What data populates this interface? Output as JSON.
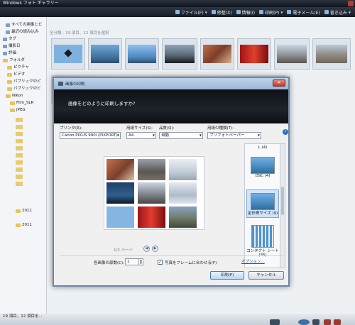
{
  "window": {
    "title": "Windows フォト ギャラリー",
    "toolbar": [
      "ファイル(F)",
      "修整(X)",
      "情報(I)",
      "印刷(P)",
      "電子メール(E)",
      "書き込み"
    ],
    "search_placeholder": "",
    "count_label": "全分類 - 19 項目、12 項目を選択"
  },
  "sidebar": {
    "items": [
      "すべての画像とビ",
      "最近の読み込み",
      "タグ",
      "撮影日",
      "評価",
      "フォルダ",
      "ピクチャ",
      "ビデオ",
      "パブリックのピ",
      "パブリックのビ",
      "Nikon",
      "Film_SLR",
      "JPEG",
      "2011",
      "2011"
    ]
  },
  "status": {
    "text": "19 項目、12 項目を..."
  },
  "dialog": {
    "title": "画像の印刷",
    "question": "画像をどのように印刷しますか?",
    "printer_label": "プリンタ(R):",
    "printer_value": "Canon PIXUS 990i (PIXPORT)",
    "paper_size_label": "用紙サイズ(S):",
    "paper_size_value": "A4",
    "quality_label": "品質(Q):",
    "quality_value": "自動",
    "paper_type_label": "用紙の種類(T):",
    "paper_type_value": "プリフォトペーパー",
    "page_indicator": "1/2 ページ",
    "copies_label": "各画像の部数(C):",
    "copies_value": "1",
    "fit_label": "写真をフレームに合わせる(F)",
    "options_link": "オプション...",
    "print_button": "印刷(P)",
    "cancel_button": "キャンセル",
    "sizes": [
      {
        "label": "L (4)"
      },
      {
        "label": "DSC (4)"
      },
      {
        "label": "定形寄サイズ (9)"
      },
      {
        "label": "コンタクト シート (35)"
      }
    ]
  },
  "colors": {
    "accent": "#2c6ec6",
    "dialog_header": "#111417"
  }
}
